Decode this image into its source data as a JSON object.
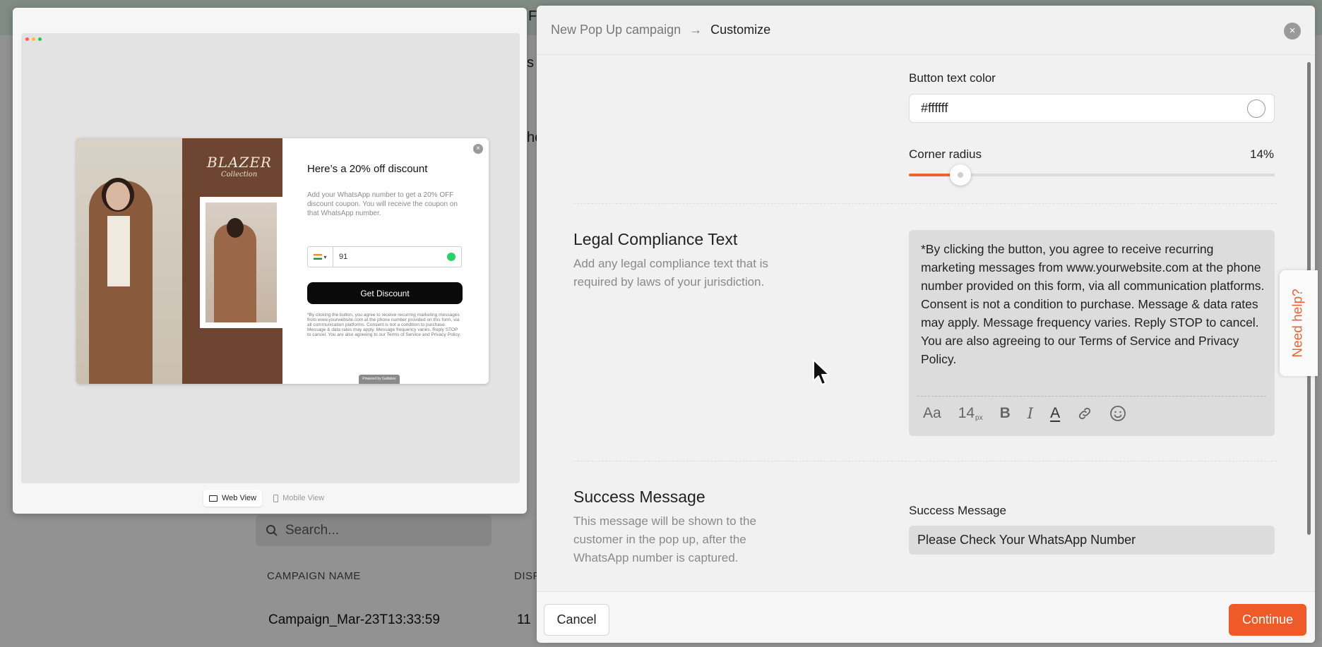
{
  "background": {
    "fragment_1": "F",
    "fragment_2": "s",
    "fragment_3": "he",
    "search_placeholder": "Search...",
    "col_campaign_name": "CAMPAIGN NAME",
    "col_display": "DISP",
    "row_campaign": "Campaign_Mar-23T13:33:59",
    "row_value": "11"
  },
  "preview": {
    "popup_title": "Here’s a 20% off discount",
    "popup_description": "Add your WhatsApp number to get a 20% OFF discount coupon. You will receive the coupon on that WhatsApp number.",
    "phone_value": "91",
    "popup_button": "Get Discount",
    "popup_legal": "*By clicking the button, you agree to receive recurring marketing messages from www.yourwebsite.com at the phone number provided on this form, via all communication platforms. Consent is not a condition to purchase. Message & data rates may apply. Message frequency varies. Reply STOP to cancel. You are also agreeing to our Terms of Service and Privacy Policy.",
    "brand_title": "BLAZER",
    "brand_subtitle": "Collection",
    "powered_by": "Powered by Gallabox",
    "web_view": "Web View",
    "mobile_view": "Mobile View"
  },
  "panel": {
    "breadcrumb_1": "New Pop Up campaign",
    "breadcrumb_arrow": "→",
    "breadcrumb_2": "Customize",
    "close": "×",
    "button_text_color_label": "Button text color",
    "button_text_color_value": "#ffffff",
    "corner_radius_label": "Corner radius",
    "corner_radius_value": "14%",
    "corner_radius_fraction": 0.14,
    "legal_title": "Legal Compliance Text",
    "legal_description": "Add any legal compliance text that is required by laws of your jurisdiction.",
    "legal_text": "*By clicking the button, you agree to receive recurring marketing messages from www.yourwebsite.com at the phone number provided on this form, via all communication platforms. Consent is not a condition to purchase. Message & data rates may apply. Message frequency varies. Reply STOP to cancel. You are also agreeing to our Terms of Service and Privacy Policy.",
    "toolbar": {
      "font": "Aa",
      "size": "14",
      "size_unit": "px",
      "bold": "B",
      "italic": "I",
      "color": "A"
    },
    "success_title": "Success Message",
    "success_description": "This message will be shown to the customer in the pop up, after the WhatsApp number is captured.",
    "success_field_label": "Success Message",
    "success_field_value": "Please Check Your WhatsApp Number",
    "cancel": "Cancel",
    "continue": "Continue"
  },
  "help_tab": "Need help?",
  "colors": {
    "accent": "#f05a28",
    "whatsapp": "#25d366",
    "popup_button": "#0a0a0a"
  }
}
